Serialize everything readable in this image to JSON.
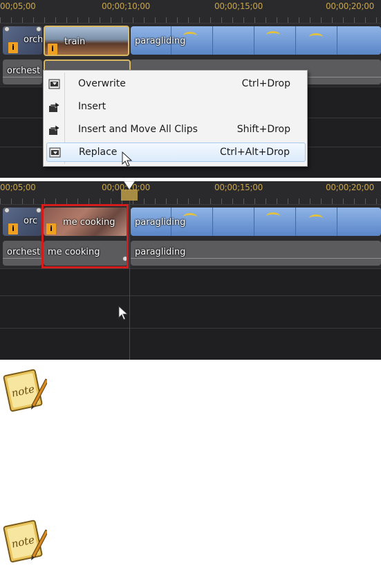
{
  "timeline": {
    "timecodes": [
      "00;05;00",
      "00;00;10;00",
      "00;00;15;00",
      "00;00;20;00"
    ],
    "timecodes_b": [
      "00;05;00",
      "00;00;10;00",
      "00;00;15;00",
      "00;00;20;00"
    ]
  },
  "top": {
    "clip_orch_video": "orch",
    "clip_train": "train",
    "clip_paragliding": "paragliding",
    "clip_orch_audio": "orchest",
    "menu": [
      {
        "label": "Overwrite",
        "shortcut": "Ctrl+Drop",
        "icon": "overwrite-icon"
      },
      {
        "label": "Insert",
        "shortcut": "",
        "icon": "insert-icon"
      },
      {
        "label": "Insert and Move All Clips",
        "shortcut": "Shift+Drop",
        "icon": "insert-move-icon"
      },
      {
        "label": "Replace",
        "shortcut": "Ctrl+Alt+Drop",
        "icon": "replace-icon"
      }
    ]
  },
  "bottom": {
    "clip_orch_video": "orc",
    "clip_cooking_video": "me cooking",
    "clip_paragliding": "paragliding",
    "clip_orch_audio": "orchest",
    "clip_cooking_audio": "me cooking",
    "clip_paragliding_audio": "paragliding"
  },
  "colors": {
    "timecode": "#c8a54a",
    "highlight_box": "#d41c1c",
    "playhead": "#c01818",
    "badge": "#f0a020"
  }
}
